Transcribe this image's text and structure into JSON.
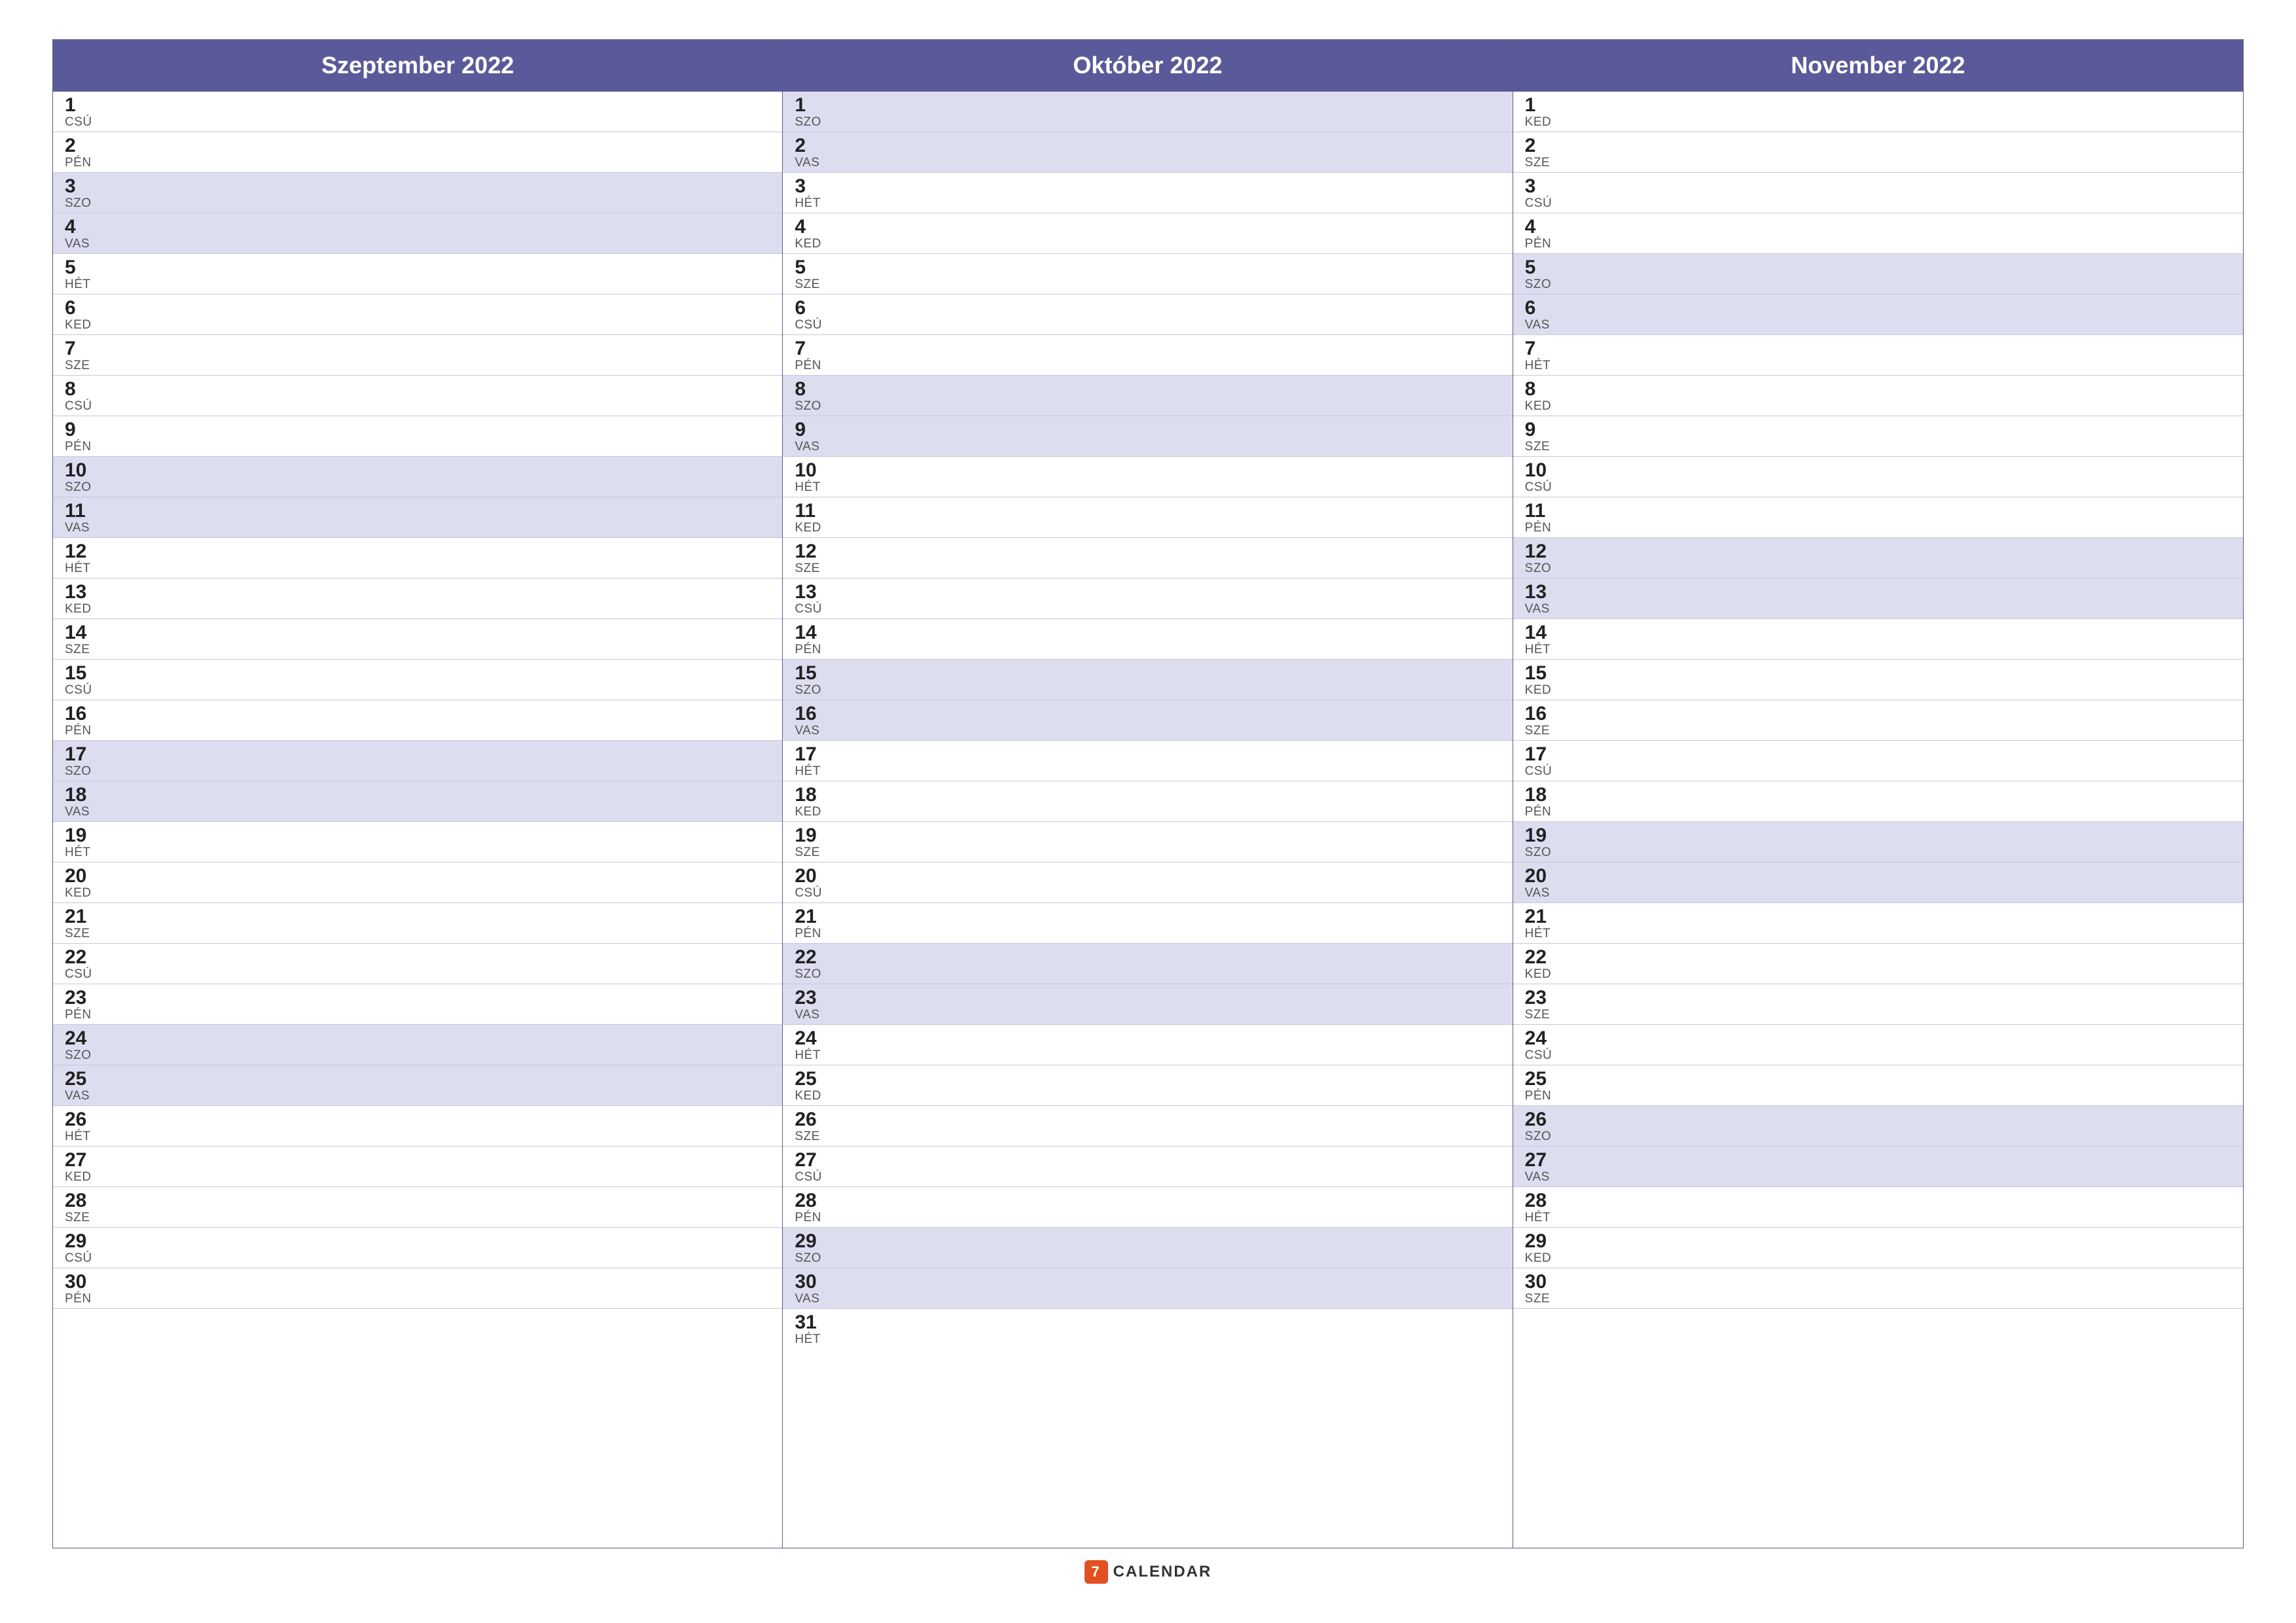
{
  "months": [
    {
      "name": "Szeptember 2022",
      "days": [
        {
          "num": "1",
          "abbr": "CSÚ",
          "weekend": false
        },
        {
          "num": "2",
          "abbr": "PÉN",
          "weekend": false
        },
        {
          "num": "3",
          "abbr": "SZO",
          "weekend": true
        },
        {
          "num": "4",
          "abbr": "VAS",
          "weekend": true
        },
        {
          "num": "5",
          "abbr": "HÉT",
          "weekend": false
        },
        {
          "num": "6",
          "abbr": "KED",
          "weekend": false
        },
        {
          "num": "7",
          "abbr": "SZE",
          "weekend": false
        },
        {
          "num": "8",
          "abbr": "CSÚ",
          "weekend": false
        },
        {
          "num": "9",
          "abbr": "PÉN",
          "weekend": false
        },
        {
          "num": "10",
          "abbr": "SZO",
          "weekend": true
        },
        {
          "num": "11",
          "abbr": "VAS",
          "weekend": true
        },
        {
          "num": "12",
          "abbr": "HÉT",
          "weekend": false
        },
        {
          "num": "13",
          "abbr": "KED",
          "weekend": false
        },
        {
          "num": "14",
          "abbr": "SZE",
          "weekend": false
        },
        {
          "num": "15",
          "abbr": "CSÚ",
          "weekend": false
        },
        {
          "num": "16",
          "abbr": "PÉN",
          "weekend": false
        },
        {
          "num": "17",
          "abbr": "SZO",
          "weekend": true
        },
        {
          "num": "18",
          "abbr": "VAS",
          "weekend": true
        },
        {
          "num": "19",
          "abbr": "HÉT",
          "weekend": false
        },
        {
          "num": "20",
          "abbr": "KED",
          "weekend": false
        },
        {
          "num": "21",
          "abbr": "SZE",
          "weekend": false
        },
        {
          "num": "22",
          "abbr": "CSÚ",
          "weekend": false
        },
        {
          "num": "23",
          "abbr": "PÉN",
          "weekend": false
        },
        {
          "num": "24",
          "abbr": "SZO",
          "weekend": true
        },
        {
          "num": "25",
          "abbr": "VAS",
          "weekend": true
        },
        {
          "num": "26",
          "abbr": "HÉT",
          "weekend": false
        },
        {
          "num": "27",
          "abbr": "KED",
          "weekend": false
        },
        {
          "num": "28",
          "abbr": "SZE",
          "weekend": false
        },
        {
          "num": "29",
          "abbr": "CSÚ",
          "weekend": false
        },
        {
          "num": "30",
          "abbr": "PÉN",
          "weekend": false
        }
      ]
    },
    {
      "name": "Október 2022",
      "days": [
        {
          "num": "1",
          "abbr": "SZO",
          "weekend": true
        },
        {
          "num": "2",
          "abbr": "VAS",
          "weekend": true
        },
        {
          "num": "3",
          "abbr": "HÉT",
          "weekend": false
        },
        {
          "num": "4",
          "abbr": "KED",
          "weekend": false
        },
        {
          "num": "5",
          "abbr": "SZE",
          "weekend": false
        },
        {
          "num": "6",
          "abbr": "CSÚ",
          "weekend": false
        },
        {
          "num": "7",
          "abbr": "PÉN",
          "weekend": false
        },
        {
          "num": "8",
          "abbr": "SZO",
          "weekend": true
        },
        {
          "num": "9",
          "abbr": "VAS",
          "weekend": true
        },
        {
          "num": "10",
          "abbr": "HÉT",
          "weekend": false
        },
        {
          "num": "11",
          "abbr": "KED",
          "weekend": false
        },
        {
          "num": "12",
          "abbr": "SZE",
          "weekend": false
        },
        {
          "num": "13",
          "abbr": "CSÚ",
          "weekend": false
        },
        {
          "num": "14",
          "abbr": "PÉN",
          "weekend": false
        },
        {
          "num": "15",
          "abbr": "SZO",
          "weekend": true
        },
        {
          "num": "16",
          "abbr": "VAS",
          "weekend": true
        },
        {
          "num": "17",
          "abbr": "HÉT",
          "weekend": false
        },
        {
          "num": "18",
          "abbr": "KED",
          "weekend": false
        },
        {
          "num": "19",
          "abbr": "SZE",
          "weekend": false
        },
        {
          "num": "20",
          "abbr": "CSÚ",
          "weekend": false
        },
        {
          "num": "21",
          "abbr": "PÉN",
          "weekend": false
        },
        {
          "num": "22",
          "abbr": "SZO",
          "weekend": true
        },
        {
          "num": "23",
          "abbr": "VAS",
          "weekend": true
        },
        {
          "num": "24",
          "abbr": "HÉT",
          "weekend": false
        },
        {
          "num": "25",
          "abbr": "KED",
          "weekend": false
        },
        {
          "num": "26",
          "abbr": "SZE",
          "weekend": false
        },
        {
          "num": "27",
          "abbr": "CSÚ",
          "weekend": false
        },
        {
          "num": "28",
          "abbr": "PÉN",
          "weekend": false
        },
        {
          "num": "29",
          "abbr": "SZO",
          "weekend": true
        },
        {
          "num": "30",
          "abbr": "VAS",
          "weekend": true
        },
        {
          "num": "31",
          "abbr": "HÉT",
          "weekend": false
        }
      ]
    },
    {
      "name": "November 2022",
      "days": [
        {
          "num": "1",
          "abbr": "KED",
          "weekend": false
        },
        {
          "num": "2",
          "abbr": "SZE",
          "weekend": false
        },
        {
          "num": "3",
          "abbr": "CSÚ",
          "weekend": false
        },
        {
          "num": "4",
          "abbr": "PÉN",
          "weekend": false
        },
        {
          "num": "5",
          "abbr": "SZO",
          "weekend": true
        },
        {
          "num": "6",
          "abbr": "VAS",
          "weekend": true
        },
        {
          "num": "7",
          "abbr": "HÉT",
          "weekend": false
        },
        {
          "num": "8",
          "abbr": "KED",
          "weekend": false
        },
        {
          "num": "9",
          "abbr": "SZE",
          "weekend": false
        },
        {
          "num": "10",
          "abbr": "CSÚ",
          "weekend": false
        },
        {
          "num": "11",
          "abbr": "PÉN",
          "weekend": false
        },
        {
          "num": "12",
          "abbr": "SZO",
          "weekend": true
        },
        {
          "num": "13",
          "abbr": "VAS",
          "weekend": true
        },
        {
          "num": "14",
          "abbr": "HÉT",
          "weekend": false
        },
        {
          "num": "15",
          "abbr": "KED",
          "weekend": false
        },
        {
          "num": "16",
          "abbr": "SZE",
          "weekend": false
        },
        {
          "num": "17",
          "abbr": "CSÚ",
          "weekend": false
        },
        {
          "num": "18",
          "abbr": "PÉN",
          "weekend": false
        },
        {
          "num": "19",
          "abbr": "SZO",
          "weekend": true
        },
        {
          "num": "20",
          "abbr": "VAS",
          "weekend": true
        },
        {
          "num": "21",
          "abbr": "HÉT",
          "weekend": false
        },
        {
          "num": "22",
          "abbr": "KED",
          "weekend": false
        },
        {
          "num": "23",
          "abbr": "SZE",
          "weekend": false
        },
        {
          "num": "24",
          "abbr": "CSÚ",
          "weekend": false
        },
        {
          "num": "25",
          "abbr": "PÉN",
          "weekend": false
        },
        {
          "num": "26",
          "abbr": "SZO",
          "weekend": true
        },
        {
          "num": "27",
          "abbr": "VAS",
          "weekend": true
        },
        {
          "num": "28",
          "abbr": "HÉT",
          "weekend": false
        },
        {
          "num": "29",
          "abbr": "KED",
          "weekend": false
        },
        {
          "num": "30",
          "abbr": "SZE",
          "weekend": false
        }
      ]
    }
  ],
  "footer": {
    "logo_num": "7",
    "logo_text": "CALENDAR"
  },
  "colors": {
    "header_bg": "#5a5a9a",
    "weekend_bg": "#ddddf0",
    "weekday_bg": "#ffffff",
    "border": "#aaaabe",
    "logo_red": "#e05020"
  }
}
